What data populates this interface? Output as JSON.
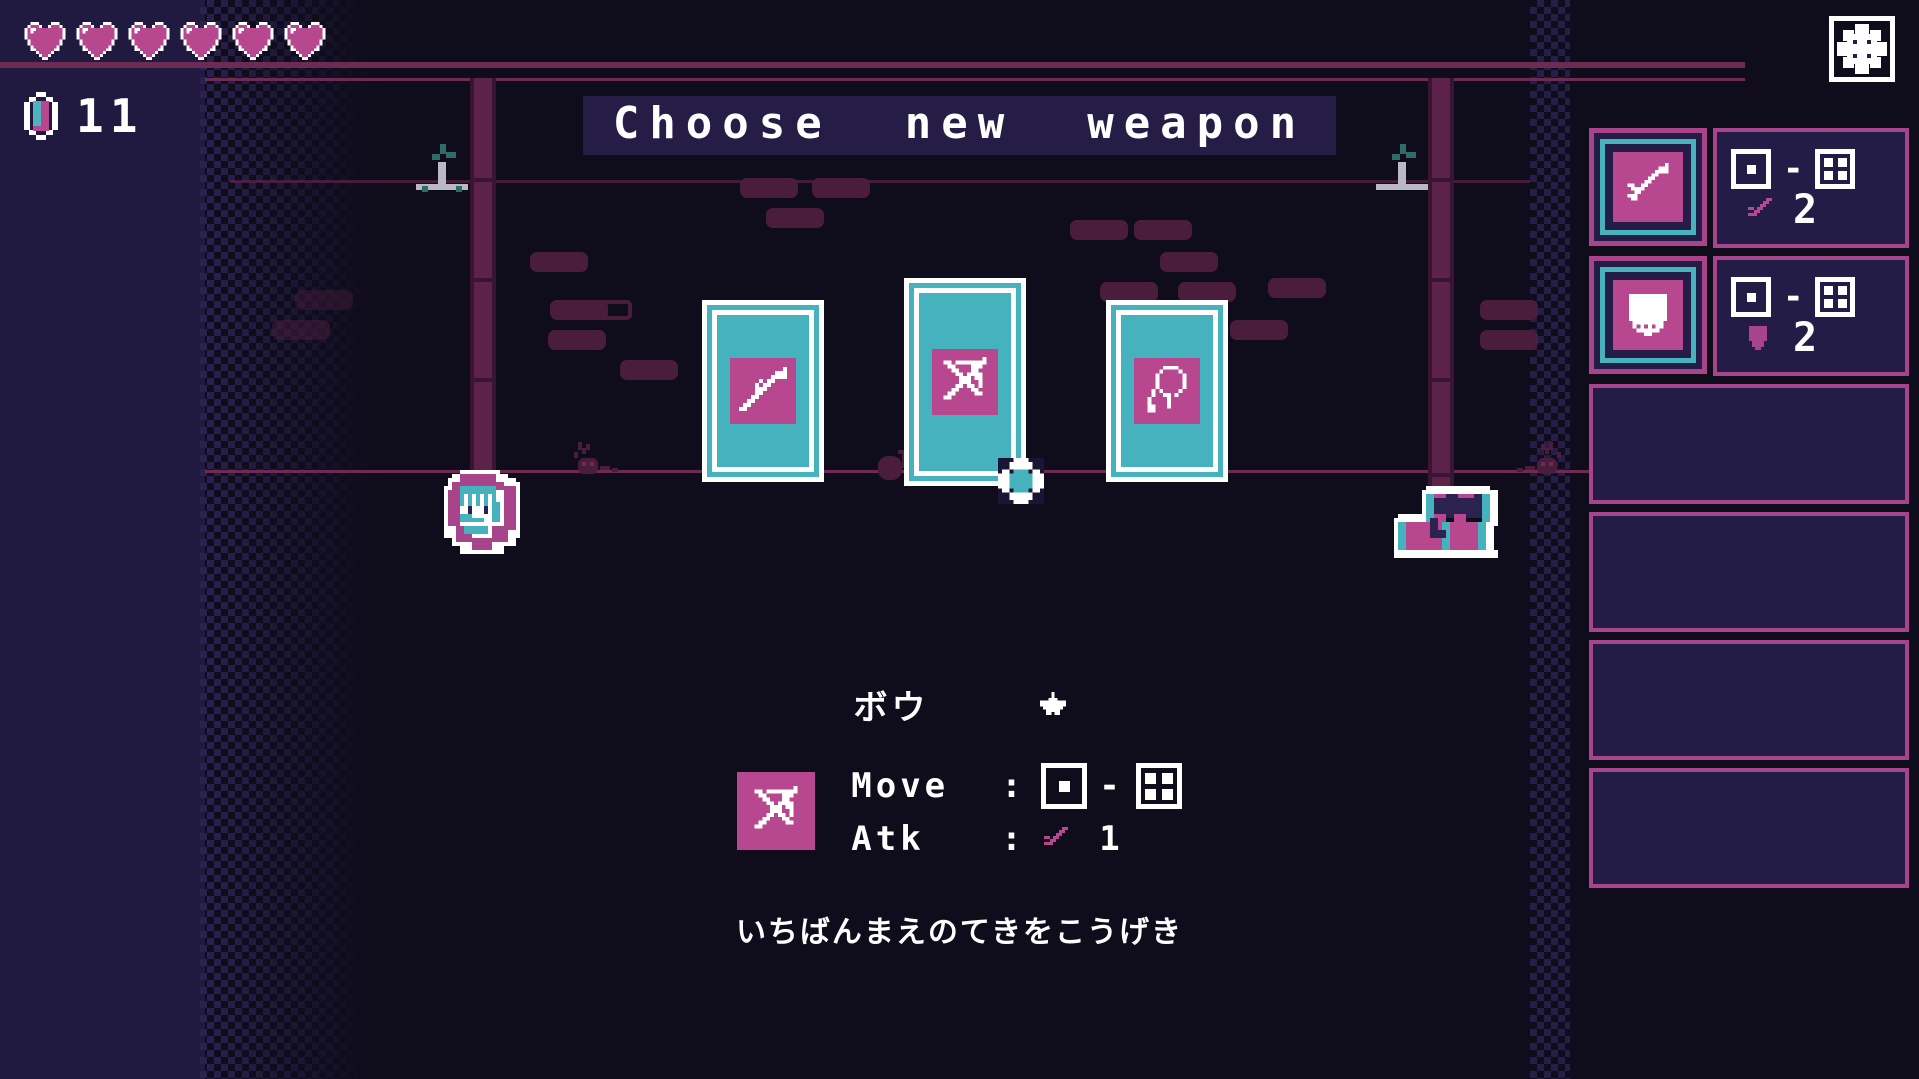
{
  "hud": {
    "hearts": {
      "count": 6,
      "icon": "heart-icon",
      "color": "#b7478f"
    },
    "gem": {
      "icon": "gem-icon",
      "count": "11",
      "cyan": "#4fb3bf",
      "magenta": "#b7478f"
    },
    "settings": {
      "icon": "gear-icon",
      "label": "Settings"
    }
  },
  "title": {
    "text": "Choose  new  weapon"
  },
  "cards": [
    {
      "id": "card-spear",
      "icon": "spear-icon",
      "selected": false
    },
    {
      "id": "card-bow",
      "icon": "bow-icon",
      "selected": true,
      "cursor": "selection-cursor"
    },
    {
      "id": "card-sling",
      "icon": "sling-icon",
      "selected": false
    }
  ],
  "detail": {
    "name": "ボウ",
    "rarity_star": "★",
    "icon": "bow-icon",
    "move_label": "Move",
    "move_colon": ":",
    "move_min_pips": 1,
    "move_max_pips": 4,
    "move_dash": "-",
    "atk_label": "Atk",
    "atk_colon": ":",
    "atk_glyph": "sword-icon",
    "atk_value": "1",
    "description": "いちばんまえのてきをこうげき"
  },
  "sidebar": {
    "slots": [
      {
        "id": "inv-slot-sword",
        "filled": true,
        "icon": "sword-icon",
        "move_min_pips": 1,
        "move_max_pips": 4,
        "move_dash": "-",
        "stat_glyph": "sword-icon",
        "stat_value": "2"
      },
      {
        "id": "inv-slot-shield",
        "filled": true,
        "icon": "shield-icon",
        "move_min_pips": 1,
        "move_max_pips": 4,
        "move_dash": "-",
        "stat_glyph": "shield-icon",
        "stat_value": "2"
      },
      {
        "id": "inv-slot-3",
        "filled": false
      },
      {
        "id": "inv-slot-4",
        "filled": false
      },
      {
        "id": "inv-slot-5",
        "filled": false
      },
      {
        "id": "inv-slot-6",
        "filled": false
      }
    ]
  },
  "scene": {
    "player": "player-sprite",
    "chest": "treasure-chest",
    "pillars": 2,
    "torches": 2
  },
  "colors": {
    "bg_dark": "#0f0c1c",
    "bg_panel": "#211a40",
    "magenta": "#b7478f",
    "cyan": "#45b2bd",
    "brick": "#4a1d3c",
    "line": "#6d2a52",
    "white": "#ffffff"
  }
}
